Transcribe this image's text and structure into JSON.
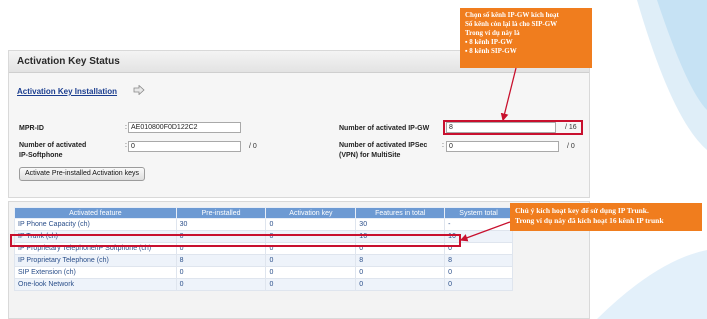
{
  "panel": {
    "title": "Activation Key Status",
    "install_link": "Activation Key Installation",
    "mpr_label": "MPR-ID",
    "mpr_value": "AE010800F0D122C2",
    "softphone_label_1": "Number of activated",
    "softphone_label_2": "IP-Softphone",
    "softphone_value": "0",
    "softphone_suffix": "/ 0",
    "ipgw_label": "Number of activated IP-GW",
    "ipgw_value": "8",
    "ipgw_suffix": "/ 16",
    "ipsec_label_1": "Number of activated IPSec",
    "ipsec_label_2": "(VPN) for MultiSite",
    "ipsec_value": "0",
    "ipsec_suffix": "/ 0",
    "colon": ":",
    "activate_button": "Activate Pre-installed Activation keys"
  },
  "table": {
    "headers": [
      "Activated feature",
      "Pre-installed",
      "Activation key",
      "Features in total",
      "System total"
    ],
    "rows": [
      [
        "IP Phone Capacity (ch)",
        "30",
        "0",
        "30",
        "-"
      ],
      [
        "IP Trunk (ch)",
        "0",
        "0",
        "16",
        "16"
      ],
      [
        "IP Proprietary Telephone/IP Softphone (ch)",
        "0",
        "0",
        "0",
        "0"
      ],
      [
        "IP Proprietary Telephone (ch)",
        "8",
        "0",
        "8",
        "8"
      ],
      [
        "SIP Extension (ch)",
        "0",
        "0",
        "0",
        "0"
      ],
      [
        "One-look Network",
        "0",
        "0",
        "0",
        "0"
      ]
    ]
  },
  "note_top": {
    "line1": "Chọn số kênh IP-GW kích hoạt",
    "line2": "Số kênh còn lại là cho SIP-GW",
    "line3": "Trong ví dụ này là",
    "bullet1": "8 kênh IP-GW",
    "bullet2": "8 kênh SIP-GW"
  },
  "note_bottom": {
    "line1": "Chú ý kích hoạt key để sử dụng IP Trunk.",
    "line2": "Trong ví dụ này đã kích hoạt 16 kênh IP trunk"
  },
  "colors": {
    "header_blue": "#6d9ad3",
    "callout_orange": "#f07d1e",
    "highlight_red": "#c8102e",
    "link_blue": "#1a3d8f"
  },
  "icons": {
    "install_arrow": "arrow-right-icon"
  }
}
